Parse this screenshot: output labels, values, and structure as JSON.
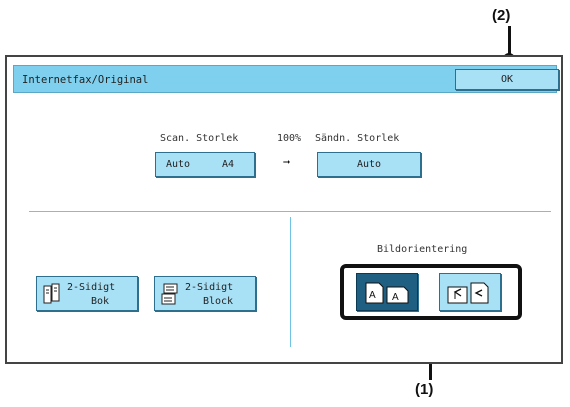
{
  "callouts": {
    "ok": "(2)",
    "orientation": "(1)"
  },
  "window": {
    "title": "Internetfax/Original"
  },
  "ok_button": {
    "label": "OK"
  },
  "scan": {
    "label": "Scan. Storlek",
    "ratio": "100%",
    "arrow": "➞",
    "button_left": "Auto",
    "button_right": "A4"
  },
  "send": {
    "label": "Sändn. Storlek",
    "button": "Auto"
  },
  "duplex_book": {
    "line1": "2-Sidigt",
    "line2": "Bok"
  },
  "duplex_block": {
    "line1": "2-Sidigt",
    "line2": "Block"
  },
  "orientation": {
    "label": "Bildorientering",
    "selected": "portrait"
  },
  "colors": {
    "title_bar": "#7fd0ee",
    "button": "#a8e0f6",
    "selected": "#1f5f82"
  }
}
